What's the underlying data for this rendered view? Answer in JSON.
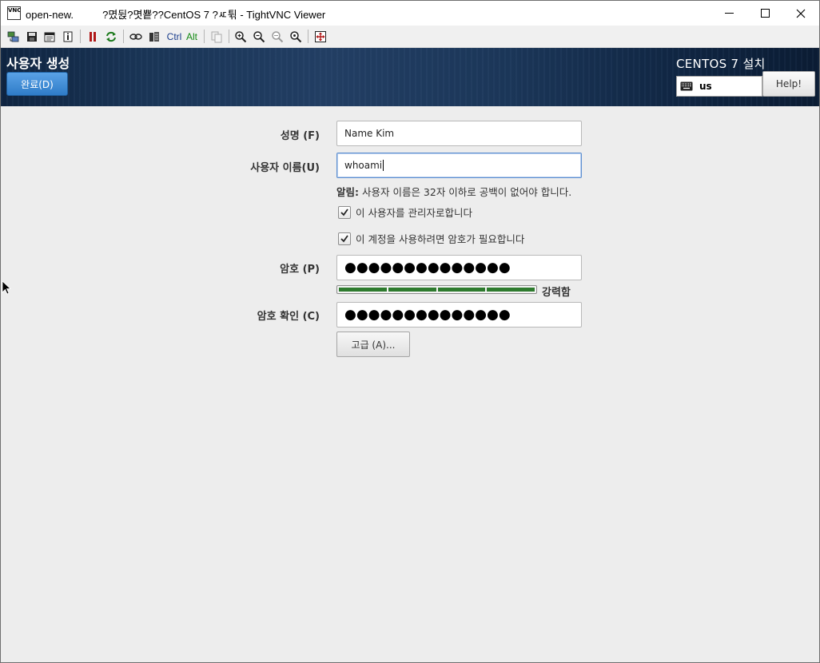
{
  "window": {
    "title": "open-new.          ?몄뒩?몃뿉??CentOS 7 ?ㅼ튂 - TightVNC Viewer",
    "app_icon_text": "VNC",
    "controls": [
      "minimize",
      "maximize",
      "close"
    ]
  },
  "toolbar": {
    "buttons": [
      "new-connection-icon",
      "save-icon",
      "options-icon",
      "info-icon",
      "pause-icon",
      "refresh-icon",
      "send-ctrl-alt-del-icon",
      "send-ctrl-esc-icon",
      "ctrl-icon",
      "alt-icon",
      "clipboard-icon",
      "zoom-in-icon",
      "zoom-out-icon",
      "zoom-100-icon",
      "zoom-fit-icon",
      "fullscreen-icon"
    ],
    "ctrl_label": "Ctrl",
    "alt_label": "Alt"
  },
  "header": {
    "page_title": "사용자 생성",
    "done_label": "완료(D)",
    "install_title": "CENTOS 7 설치",
    "keyboard_layout": "us",
    "help_label": "Help!"
  },
  "form": {
    "fullname_label": "성명 (F)",
    "fullname_value": "Name Kim",
    "username_label": "사용자 이름(U)",
    "username_value": "whoami",
    "hint_bold": "알림:",
    "hint_text": " 사용자 이름은 32자 이하로 공백이 없어야 합니다.",
    "admin_checkbox_label": "이 사용자를 관리자로합니다",
    "admin_checked": true,
    "require_password_label": "이 계정을 사용하려면 암호가 필요합니다",
    "require_password_checked": true,
    "password_label": "암호 (P)",
    "password_value": "●●●●●●●●●●●●●●",
    "strength_label": "강력함",
    "strength_level": 1.0,
    "confirm_label": "암호 확인 (C)",
    "confirm_value": "●●●●●●●●●●●●●●",
    "advanced_label": "고급 (A)..."
  },
  "colors": {
    "banner": "#1a3556",
    "done_button": "#3d8ad6",
    "strength_bar": "#2d7a2d",
    "background": "#ededed"
  }
}
